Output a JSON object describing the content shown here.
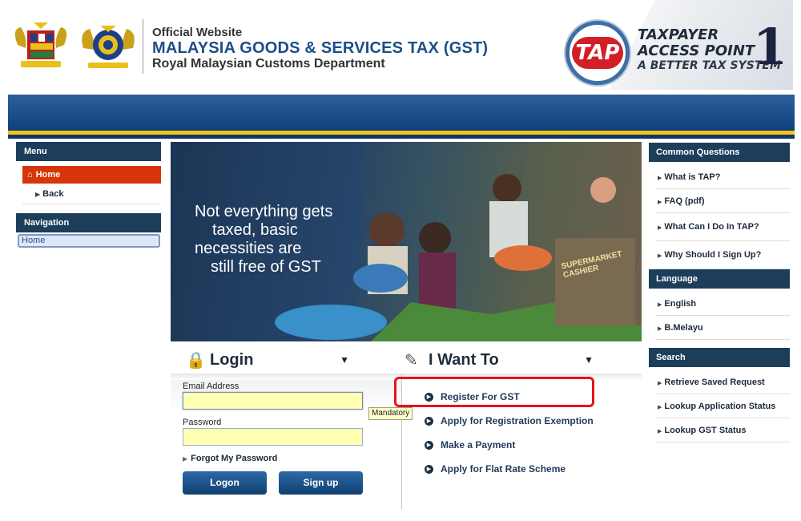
{
  "header": {
    "official": "Official Website",
    "title": "MALAYSIA GOODS & SERVICES TAX (GST)",
    "dept": "Royal Malaysian Customs Department",
    "tap_logo": "TAP",
    "tap_line1": "TAXPAYER",
    "tap_line2": "ACCESS POINT",
    "tap_line3": "A BETTER TAX SYSTEM",
    "tap_one": "1"
  },
  "menu": {
    "title": "Menu",
    "home": "Home",
    "back": "Back"
  },
  "navigation": {
    "title": "Navigation",
    "home": "Home"
  },
  "banner": {
    "line1": "Not everything gets",
    "line2": "taxed, basic",
    "line3": "necessities are",
    "line4": "still free of GST",
    "cashier": "SUPERMARKET CASHIER"
  },
  "login": {
    "heading": "Login",
    "email_label": "Email Address",
    "email_value": "",
    "password_label": "Password",
    "password_value": "",
    "tooltip": "Mandatory",
    "forgot": "Forgot My Password",
    "logon_button": "Logon",
    "signup_button": "Sign up"
  },
  "want": {
    "heading": "I Want To",
    "items": [
      "Register For GST",
      "Apply for Registration Exemption",
      "Make a Payment",
      "Apply for Flat Rate Scheme"
    ]
  },
  "common_questions": {
    "title": "Common Questions",
    "items": [
      "What is TAP?",
      "FAQ (pdf)",
      "What Can I Do In TAP?",
      "Why Should I Sign Up?"
    ]
  },
  "language": {
    "title": "Language",
    "items": [
      "English",
      "B.Melayu"
    ]
  },
  "search": {
    "title": "Search",
    "items": [
      "Retrieve Saved Request",
      "Lookup Application Status",
      "Lookup GST Status"
    ]
  },
  "colors": {
    "navy": "#1c3e5a",
    "home_active": "#d7350a",
    "highlight": "#e5141c",
    "field_bg": "#ffffb4",
    "gold": "#f5c51a"
  }
}
